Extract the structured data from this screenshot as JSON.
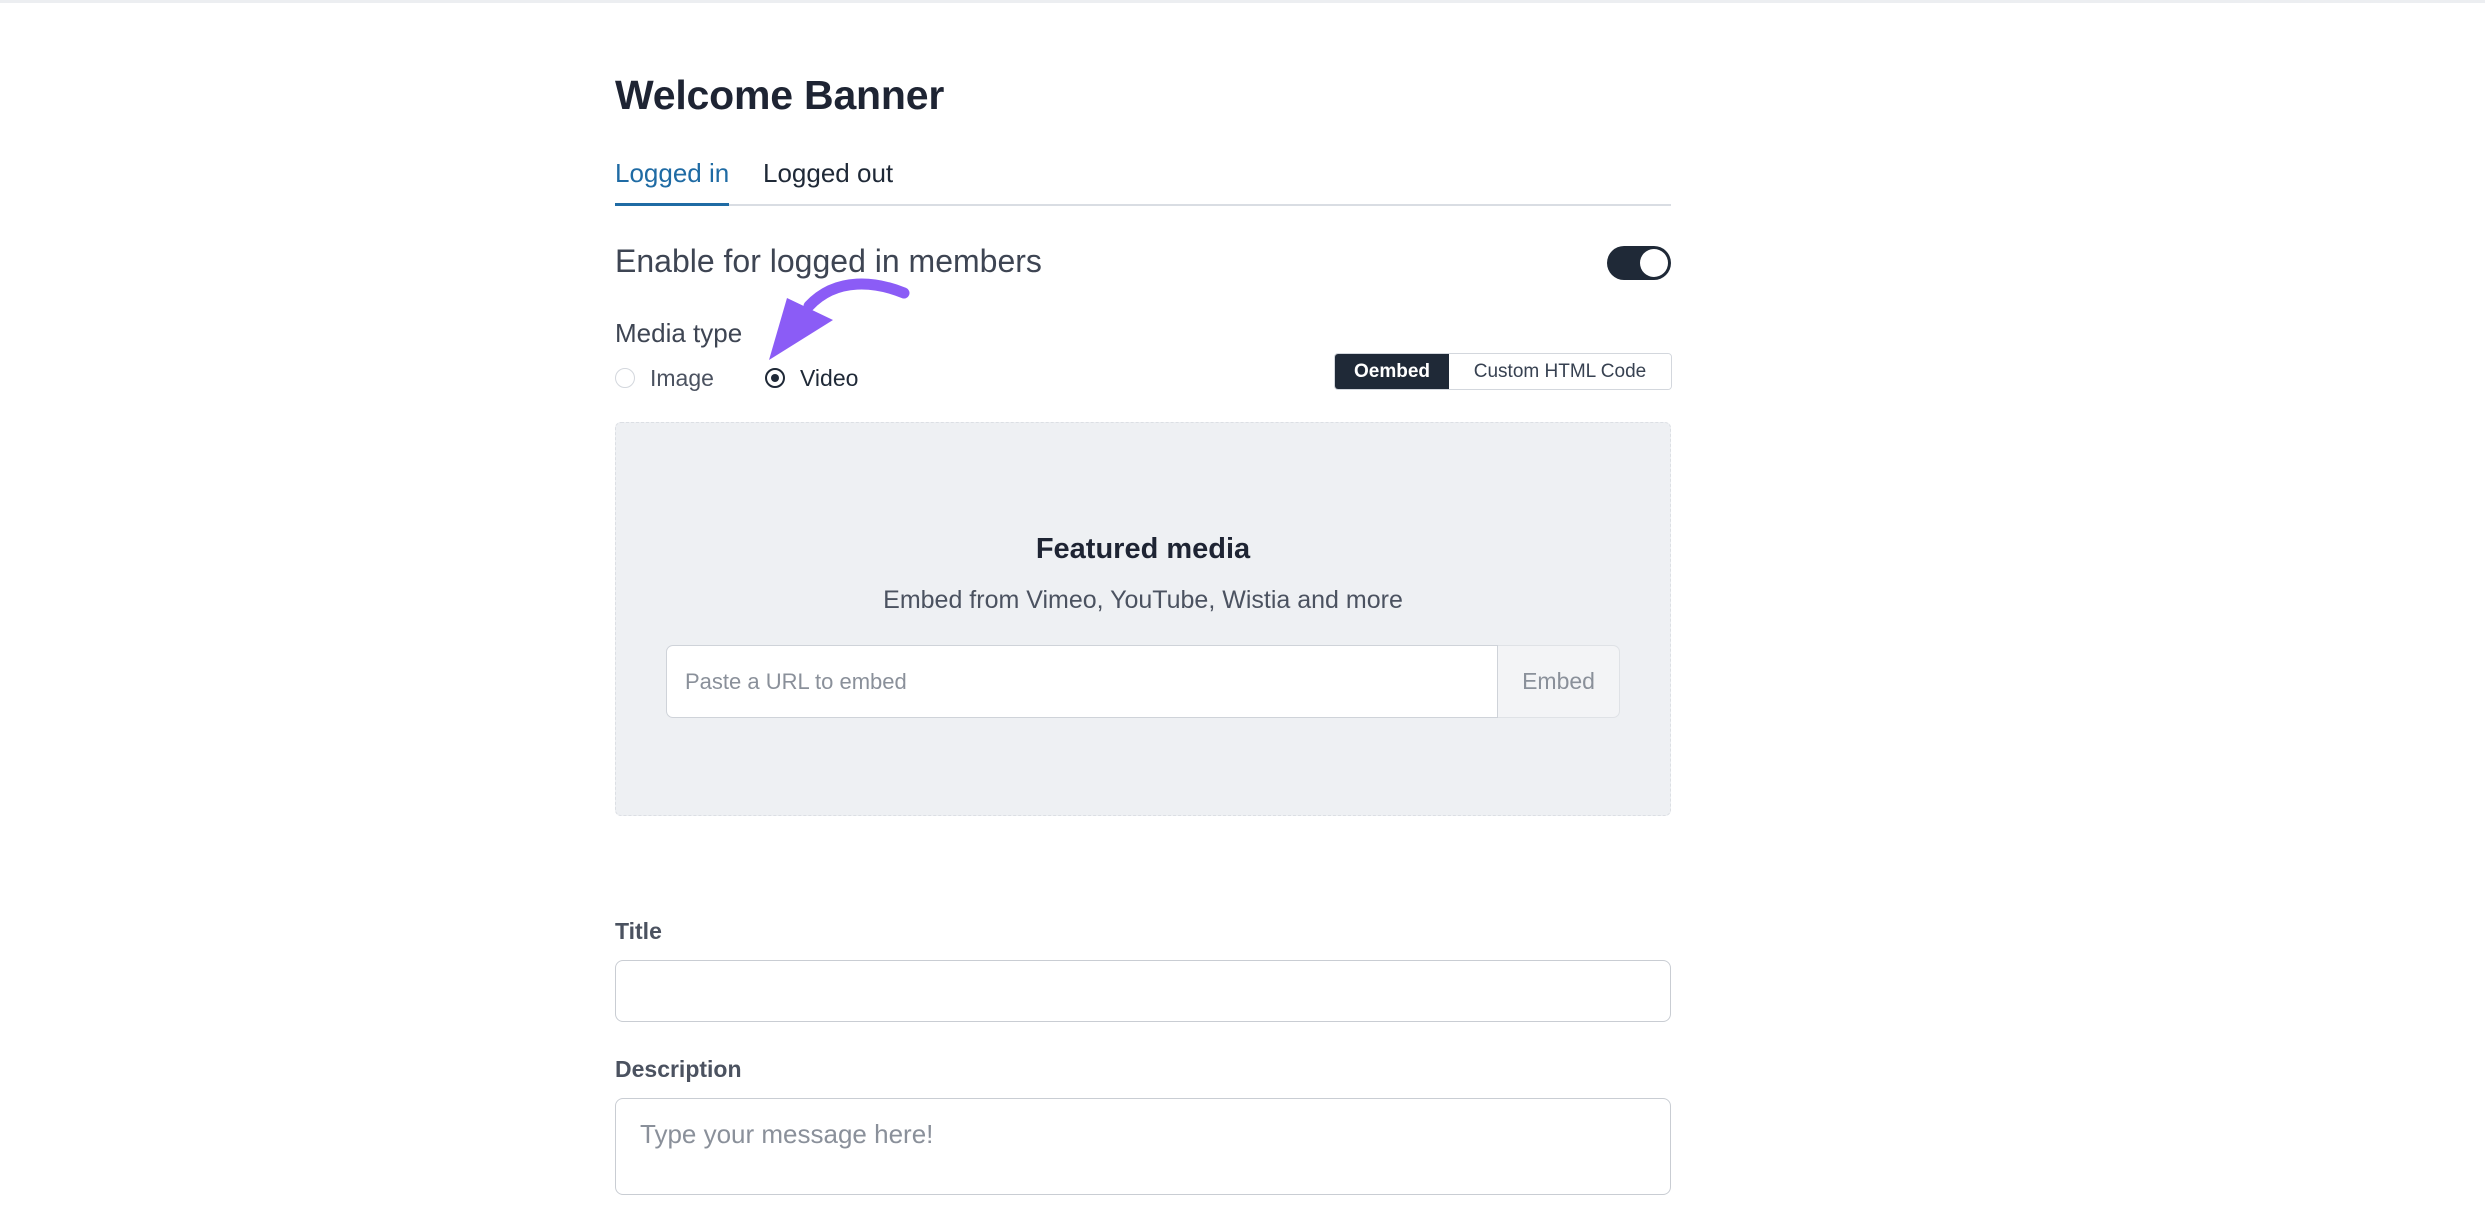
{
  "page": {
    "title": "Welcome Banner"
  },
  "tabs": [
    {
      "label": "Logged in",
      "active": true
    },
    {
      "label": "Logged out",
      "active": false
    }
  ],
  "enable_section": {
    "heading": "Enable for logged in members",
    "toggle_on": true
  },
  "media_type": {
    "label": "Media type",
    "options": [
      {
        "label": "Image",
        "checked": false
      },
      {
        "label": "Video",
        "checked": true
      }
    ],
    "annotation_arrow_color": "#8b5cf6"
  },
  "embed_mode": {
    "options": [
      {
        "label": "Oembed",
        "active": true
      },
      {
        "label": "Custom HTML Code",
        "active": false
      }
    ]
  },
  "featured_media": {
    "title": "Featured media",
    "subtitle": "Embed from Vimeo, YouTube, Wistia and more",
    "input_placeholder": "Paste a URL to embed",
    "input_value": "",
    "button_label": "Embed"
  },
  "title_field": {
    "label": "Title",
    "value": ""
  },
  "description_field": {
    "label": "Description",
    "placeholder": "Type your message here!",
    "value": ""
  },
  "colors": {
    "accent": "#1f6ba4",
    "dark": "#1f2937",
    "panel_bg": "#eef0f3"
  }
}
